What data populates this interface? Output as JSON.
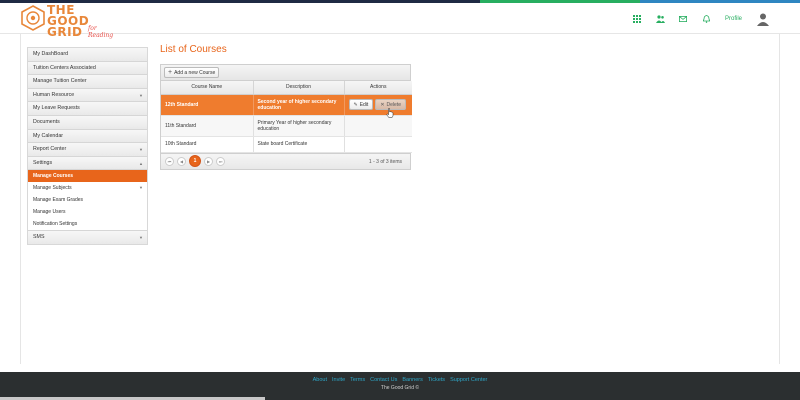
{
  "brand": {
    "logo_text_line1": "THE GOOD",
    "logo_text_line2": "GRID",
    "tagline": "for Reading",
    "accent_color": "#e8651b",
    "link_color": "#27ae60"
  },
  "header": {
    "icons": [
      "grid-icon",
      "users-icon",
      "mail-icon",
      "bell-icon"
    ],
    "profile_label": "Profile"
  },
  "sidebar": {
    "items": [
      {
        "label": "My DashBoard"
      },
      {
        "label": "Tuition Centers Associated"
      },
      {
        "label": "Manage Tuition Center"
      },
      {
        "label": "Human Resource",
        "caret": "▼"
      },
      {
        "label": "My Leave Requests"
      },
      {
        "label": "Documents"
      },
      {
        "label": "My Calendar"
      },
      {
        "label": "Report Center",
        "caret": "▼"
      },
      {
        "label": "Settings",
        "caret": "▲"
      }
    ],
    "settings_sub": [
      {
        "label": "Manage Courses"
      },
      {
        "label": "Manage Subjects",
        "caret": "▼"
      },
      {
        "label": "Manage Exam Grades"
      },
      {
        "label": "Manage Users"
      },
      {
        "label": "Notification Settings"
      }
    ],
    "last_item": {
      "label": "SMS",
      "caret": "▼"
    }
  },
  "main": {
    "title": "List of Courses",
    "add_button": "Add a new Course",
    "columns": [
      "Course Name",
      "Description",
      "Actions"
    ],
    "rows": [
      {
        "name": "12th Standard",
        "description": "Second year of higher secondary education"
      },
      {
        "name": "11th Standard",
        "description": "Primary Year of higher secondary education"
      },
      {
        "name": "10th Standard",
        "description": "State board Certificate"
      }
    ],
    "edit_label": "Edit",
    "delete_label": "Delete",
    "pager": {
      "first": "⏮",
      "prev": "◀",
      "current": "1",
      "next": "▶",
      "last": "⏭",
      "info": "1 - 3 of 3 items"
    }
  },
  "footer": {
    "links": [
      "About",
      "Invite",
      "Terms",
      "Contact Us",
      "Banners",
      "Tickets",
      "Support Center"
    ],
    "copyright": "The Good Grid ©"
  }
}
